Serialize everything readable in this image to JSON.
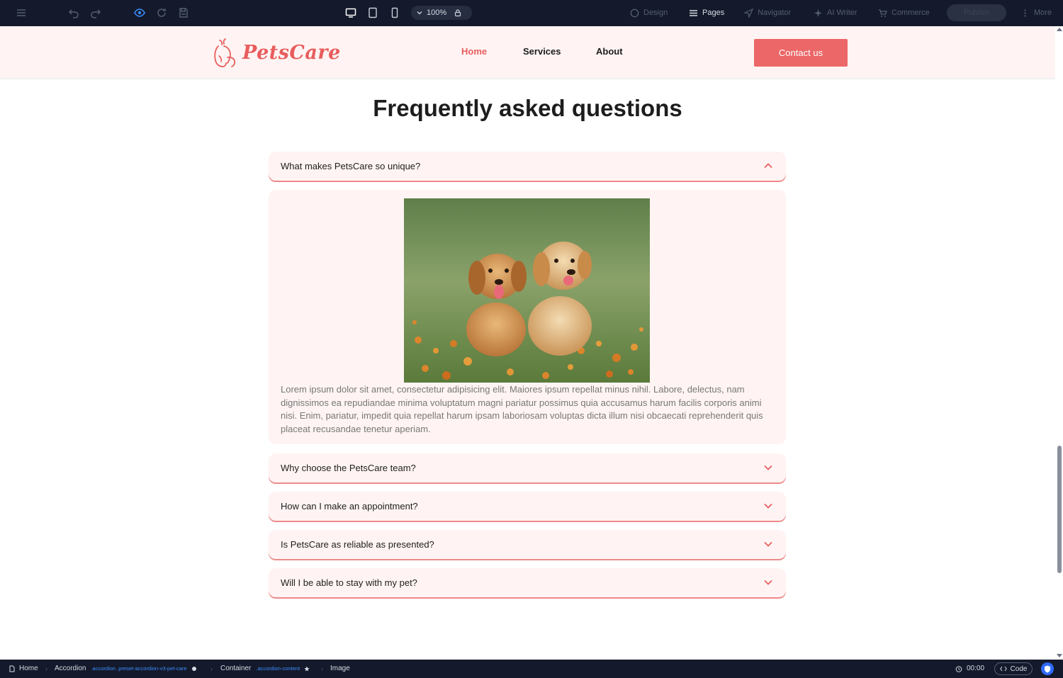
{
  "toolbar": {
    "zoom": "100%",
    "design_label": "Design",
    "pages_label": "Pages",
    "navigator_label": "Navigator",
    "ai_writer_label": "AI Writer",
    "commerce_label": "Commerce",
    "publish_label": "Publish",
    "more_label": "More"
  },
  "site": {
    "logo_text": "PetsCare",
    "nav": [
      {
        "label": "Home",
        "active": true
      },
      {
        "label": "Services",
        "active": false
      },
      {
        "label": "About",
        "active": false
      }
    ],
    "contact_label": "Contact us"
  },
  "faq": {
    "title": "Frequently asked questions",
    "items": [
      {
        "question": "What makes PetsCare so unique?",
        "expanded": true
      },
      {
        "question": "Why choose the PetsCare team?",
        "expanded": false
      },
      {
        "question": "How can I make an appointment?",
        "expanded": false
      },
      {
        "question": "Is PetsCare as reliable as presented?",
        "expanded": false
      },
      {
        "question": "Will I be able to stay with my pet?",
        "expanded": false
      }
    ],
    "answer_text": "Lorem ipsum dolor sit amet, consectetur adipisicing elit. Maiores ipsum repellat minus nihil. Labore, delectus, nam dignissimos ea repudiandae minima voluptatum magni pariatur possimus quia accusamus harum facilis corporis animi nisi. Enim, pariatur, impedit quia repellat harum ipsam laboriosam voluptas dicta illum nisi obcaecati reprehenderit quis placeat recusandae tenetur aperiam."
  },
  "statusbar": {
    "breadcrumb": [
      {
        "label": "Home",
        "class": ""
      },
      {
        "label": "Accordion",
        "class": ".accordion .preset-accordion-v3-pet-care"
      },
      {
        "label": "Container",
        "class": ".accordion-content"
      },
      {
        "label": "Image",
        "class": ""
      }
    ],
    "time": "00:00",
    "code_label": "Code"
  },
  "colors": {
    "accent": "#ec6767",
    "header_bg": "#fff4f3",
    "editor_bg": "#141a2b"
  }
}
